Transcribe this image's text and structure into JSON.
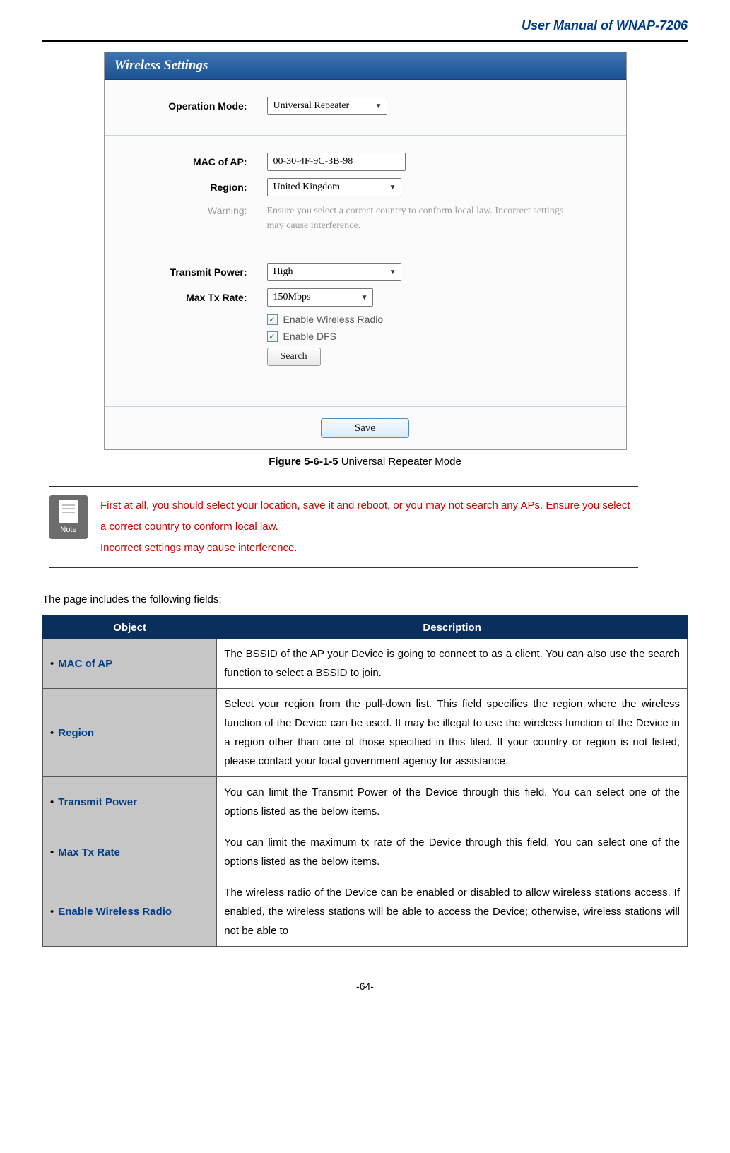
{
  "header": {
    "title": "User Manual of WNAP-7206"
  },
  "screenshot": {
    "panel_title": "Wireless Settings",
    "rows": {
      "op_mode": {
        "label": "Operation Mode:",
        "value": "Universal Repeater"
      },
      "mac": {
        "label": "MAC of AP:",
        "value": "00-30-4F-9C-3B-98"
      },
      "region": {
        "label": "Region:",
        "value": "United Kingdom"
      },
      "warning": {
        "label": "Warning:",
        "text": "Ensure you select a correct country to conform local law. Incorrect settings may cause interference."
      },
      "tx_power": {
        "label": "Transmit Power:",
        "value": "High"
      },
      "max_rate": {
        "label": "Max Tx Rate:",
        "value": "150Mbps"
      }
    },
    "checks": {
      "radio": "Enable Wireless Radio",
      "dfs": "Enable DFS"
    },
    "search_btn": "Search",
    "save_btn": "Save"
  },
  "figure_caption": {
    "num": "Figure 5-6-1-5",
    "text": " Universal Repeater Mode"
  },
  "note": {
    "icon_label": "Note",
    "line1": "First at all, you should select your location, save it and reboot, or you may not search any APs. Ensure you select a correct country to conform local law.",
    "line2": "Incorrect settings may cause interference."
  },
  "intro": "The page includes the following fields:",
  "table": {
    "headers": {
      "object": "Object",
      "description": "Description"
    },
    "rows": [
      {
        "obj": "MAC of AP",
        "desc": "The BSSID of the AP your Device is going to connect to as a client. You can also use the search function to select a BSSID to join."
      },
      {
        "obj": "Region",
        "desc": "Select your region from the pull-down list. This field specifies the region where the wireless function of the Device can be used. It may be illegal to use the wireless function of the Device in a region other than one of those specified in this filed. If your country or region is not listed, please contact your local government agency for assistance."
      },
      {
        "obj": "Transmit Power",
        "desc": "You can limit the Transmit Power of the Device through this field. You can select one of the options listed as the below items."
      },
      {
        "obj": "Max Tx Rate",
        "desc": "You can limit the maximum tx rate of the Device through this field. You can select one of the options listed as the below items."
      },
      {
        "obj": "Enable Wireless Radio",
        "desc": "The wireless radio of the Device can be enabled or disabled to allow wireless stations access. If enabled, the wireless stations will be able to access the Device; otherwise, wireless stations will not be able to"
      }
    ]
  },
  "page_number": "-64-"
}
